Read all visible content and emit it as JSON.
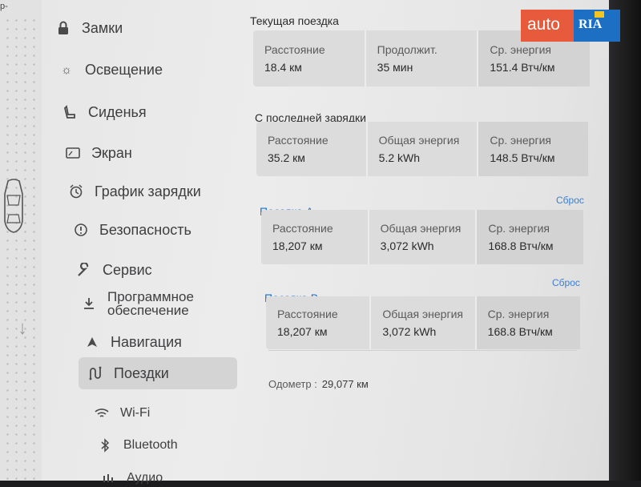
{
  "sidebar": {
    "items": [
      {
        "label": "Замки",
        "icon": "lock-icon"
      },
      {
        "label": "Освещение",
        "icon": "sun-icon"
      },
      {
        "label": "Сиденья",
        "icon": "seat-icon"
      },
      {
        "label": "Экран",
        "icon": "display-icon"
      },
      {
        "label": "График зарядки",
        "icon": "clock-icon"
      },
      {
        "label": "Безопасность",
        "icon": "alert-icon"
      },
      {
        "label": "Сервис",
        "icon": "wrench-icon"
      },
      {
        "label": "Программное\nобеспечение",
        "icon": "download-icon"
      },
      {
        "label": "Навигация",
        "icon": "navigation-icon"
      },
      {
        "label": "Поездки",
        "icon": "trips-icon",
        "active": true
      },
      {
        "label": "Wi-Fi",
        "icon": "wifi-icon"
      },
      {
        "label": "Bluetooth",
        "icon": "bluetooth-icon"
      },
      {
        "label": "Аудио",
        "icon": "audio-icon"
      }
    ]
  },
  "left_strip": {
    "text": "р-"
  },
  "current_trip": {
    "title": "Текущая поездка",
    "distance_label": "Расстояние",
    "distance_value": "18.4 км",
    "duration_label": "Продолжит.",
    "duration_value": "35 мин",
    "avg_label": "Ср. энергия",
    "avg_value": "151.4 Втч/км"
  },
  "since_charge": {
    "title": "С последней зарядки",
    "distance_label": "Расстояние",
    "distance_value": "35.2 км",
    "energy_label": "Общая энергия",
    "energy_value": "5.2 kWh",
    "avg_label": "Ср. энергия",
    "avg_value": "148.5 Втч/км"
  },
  "trip_a": {
    "title": "Поездка A",
    "reset": "Сброс",
    "distance_label": "Расстояние",
    "distance_value": "18,207 км",
    "energy_label": "Общая энергия",
    "energy_value": "3,072 kWh",
    "avg_label": "Ср. энергия",
    "avg_value": "168.8 Втч/км"
  },
  "trip_b": {
    "title": "Поездка B",
    "reset": "Сброс",
    "distance_label": "Расстояние",
    "distance_value": "18,207 км",
    "energy_label": "Общая энергия",
    "energy_value": "3,072 kWh",
    "avg_label": "Ср. энергия",
    "avg_value": "168.8 Втч/км"
  },
  "odometer": {
    "label": "Одометр :",
    "value": "29,077 км"
  },
  "watermark": {
    "left": "auto",
    "right": "RIA"
  },
  "colors": {
    "accent": "#1a6fd6",
    "watermark_red": "#e85a3c",
    "watermark_blue": "#1c6fc2"
  }
}
